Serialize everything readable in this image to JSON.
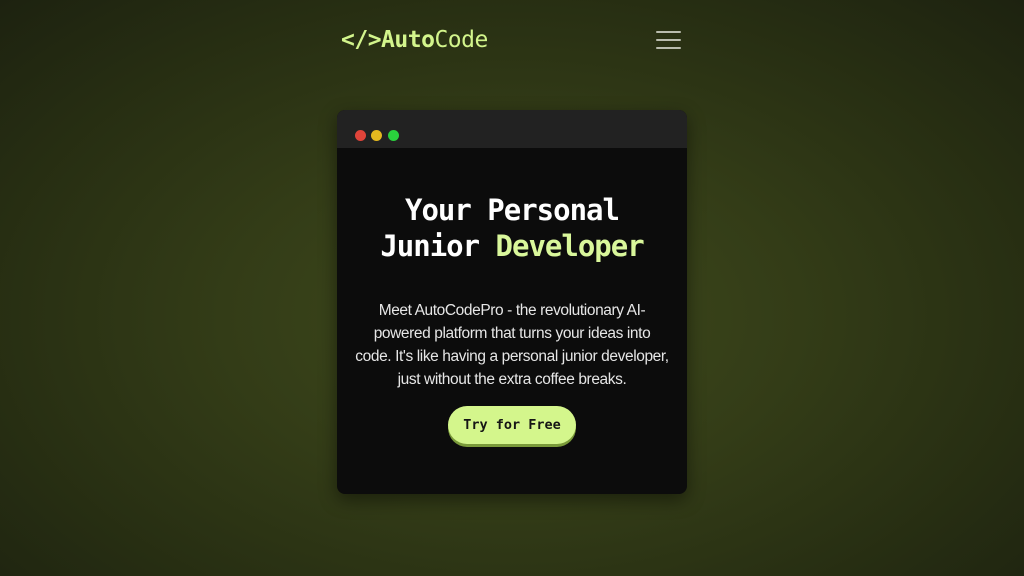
{
  "header": {
    "logo_symbol": "</>",
    "logo_bold": "Auto",
    "logo_light": "Code",
    "menu_icon": "hamburger-menu-icon"
  },
  "hero": {
    "window_dots": [
      "red",
      "yellow",
      "green"
    ],
    "headline_line1": "Your Personal",
    "headline_line2_plain": "Junior ",
    "headline_line2_accent": "Developer",
    "description": "Meet AutoCodePro - the revolutionary AI-powered platform that turns your ideas into code. It's like having a personal junior developer, just without the extra coffee breaks.",
    "cta_label": "Try for Free"
  },
  "colors": {
    "accent": "#d4f68c",
    "background": "#333c17",
    "card": "#0c0c0c",
    "titlebar": "#222222"
  }
}
